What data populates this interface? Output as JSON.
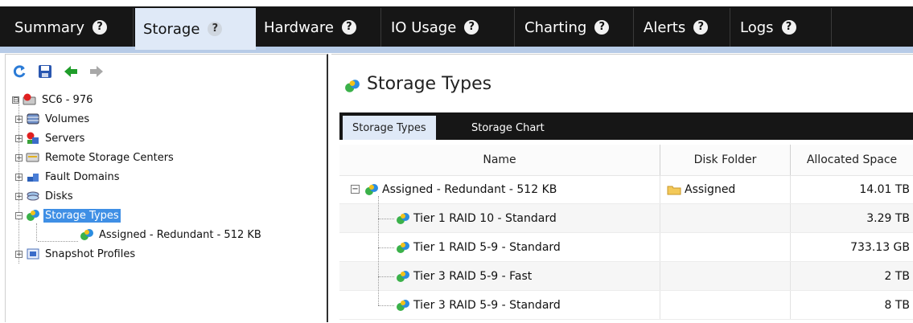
{
  "top_tabs": [
    {
      "label": "Summary",
      "active": false
    },
    {
      "label": "Storage",
      "active": true
    },
    {
      "label": "Hardware",
      "active": false
    },
    {
      "label": "IO Usage",
      "active": false
    },
    {
      "label": "Charting",
      "active": false
    },
    {
      "label": "Alerts",
      "active": false
    },
    {
      "label": "Logs",
      "active": false
    }
  ],
  "help_glyph": "?",
  "toolbar": {
    "icons": [
      "refresh-icon",
      "save-icon",
      "back-arrow-icon",
      "forward-arrow-icon"
    ]
  },
  "tree": {
    "root": {
      "label": "SC6 - 976",
      "expander": "⊟"
    },
    "items": [
      {
        "label": "Volumes",
        "expander": "+",
        "icon": "volumes-icon"
      },
      {
        "label": "Servers",
        "expander": "+",
        "icon": "servers-icon"
      },
      {
        "label": "Remote Storage Centers",
        "expander": "+",
        "icon": "remote-storage-icon"
      },
      {
        "label": "Fault Domains",
        "expander": "+",
        "icon": "fault-domains-icon"
      },
      {
        "label": "Disks",
        "expander": "+",
        "icon": "disks-icon"
      },
      {
        "label": "Storage Types",
        "expander": "−",
        "icon": "storage-types-icon",
        "selected": true
      },
      {
        "label": "Assigned - Redundant - 512 KB",
        "icon": "storage-type-icon"
      },
      {
        "label": "Snapshot Profiles",
        "expander": "+",
        "icon": "snapshot-profiles-icon"
      }
    ]
  },
  "main": {
    "title": "Storage Types",
    "subtabs": [
      {
        "label": "Storage Types",
        "active": true
      },
      {
        "label": "Storage Chart",
        "active": false
      }
    ],
    "columns": [
      "Name",
      "Disk Folder",
      "Allocated Space"
    ],
    "rows": [
      {
        "name": "Assigned - Redundant - 512 KB",
        "folder": "Assigned",
        "allocated": "14.01 TB",
        "expander": "−"
      },
      {
        "name": "Tier 1 RAID 10 - Standard",
        "folder": "",
        "allocated": "3.29 TB"
      },
      {
        "name": "Tier 1 RAID 5-9 - Standard",
        "folder": "",
        "allocated": "733.13 GB"
      },
      {
        "name": "Tier 3 RAID 5-9 - Fast",
        "folder": "",
        "allocated": "2 TB"
      },
      {
        "name": "Tier 3 RAID 5-9 - Standard",
        "folder": "",
        "allocated": "8 TB"
      }
    ]
  },
  "colors": {
    "tab_bar": "#161616",
    "active_tab": "#dfe9f7",
    "selection": "#3f8fe5",
    "accent_line": "#b7cbe7"
  }
}
